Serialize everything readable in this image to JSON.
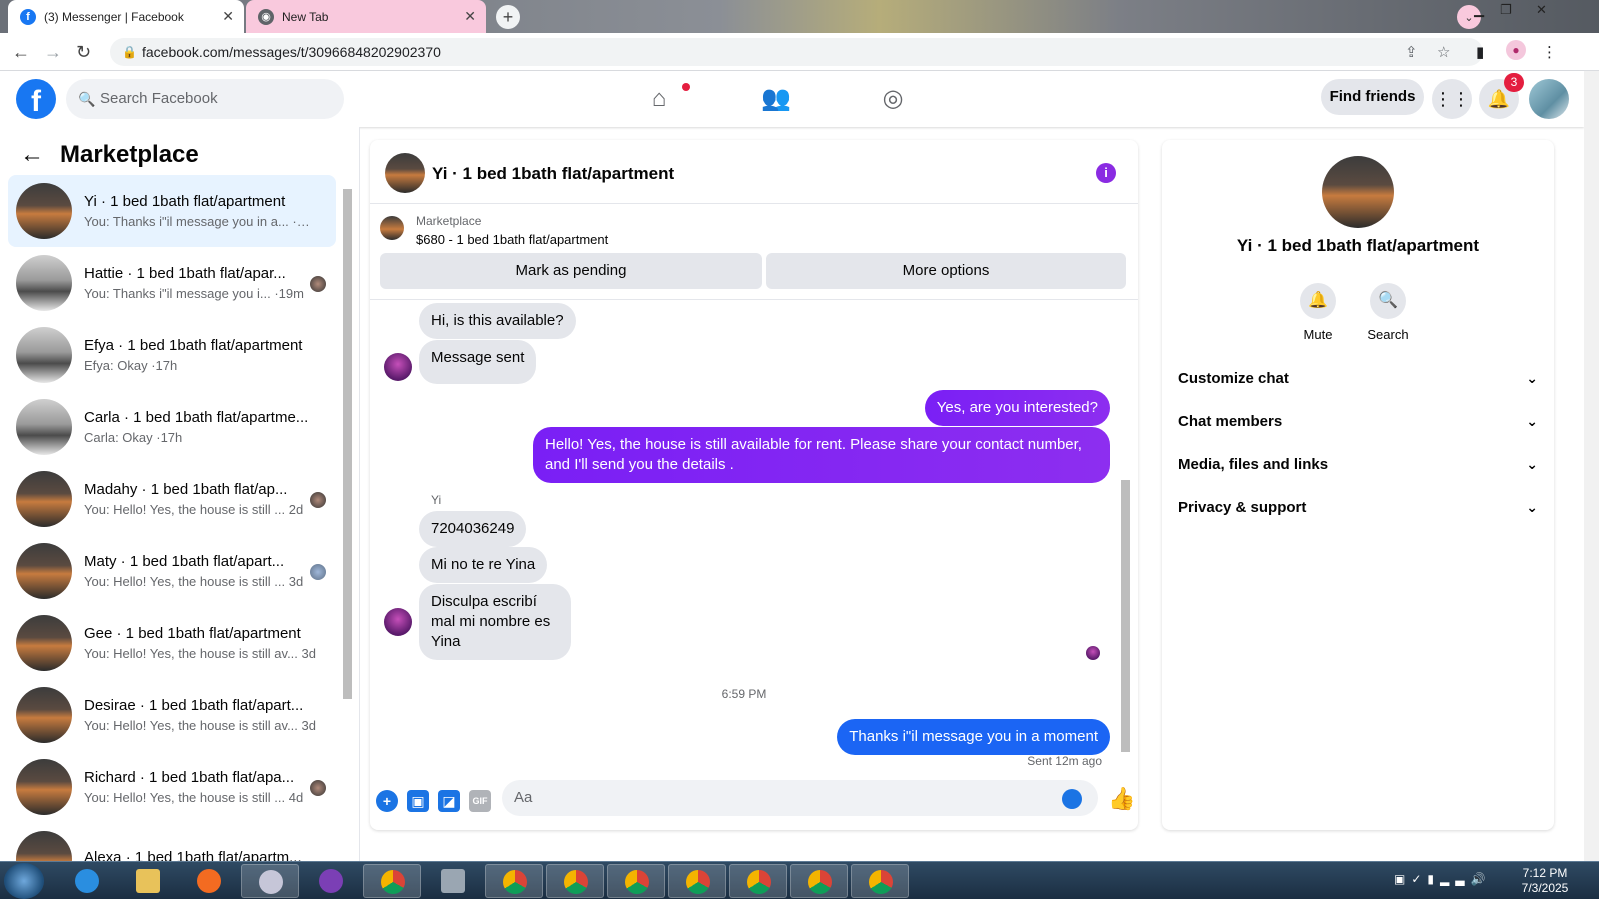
{
  "browser": {
    "tabs": [
      {
        "title": "(3) Messenger | Facebook",
        "active": true
      },
      {
        "title": "New Tab",
        "active": false
      }
    ],
    "url": "facebook.com/messages/t/30966848202902370"
  },
  "fb_nav": {
    "search_placeholder": "Search Facebook",
    "find_friends": "Find friends",
    "notification_count": "3"
  },
  "left": {
    "title": "Marketplace",
    "conversations": [
      {
        "name": "Yi · 1 bed 1bath flat/apartment",
        "snippet": "You: Thanks i\"il message you in a... ·12m"
      },
      {
        "name": "Hattie · 1 bed 1bath flat/apar...",
        "snippet": "You: Thanks i\"il message you i... ·19m"
      },
      {
        "name": "Efya · 1 bed 1bath flat/apartment",
        "snippet": "Efya: Okay ·17h"
      },
      {
        "name": "Carla · 1 bed 1bath flat/apartme...",
        "snippet": "Carla: Okay ·17h"
      },
      {
        "name": "Madahy · 1 bed 1bath flat/ap...",
        "snippet": "You: Hello! Yes, the house is still ... 2d"
      },
      {
        "name": "Maty · 1 bed 1bath flat/apart...",
        "snippet": "You: Hello! Yes, the house is still ... 3d"
      },
      {
        "name": "Gee · 1 bed 1bath flat/apartment",
        "snippet": "You: Hello! Yes, the house is still av... 3d"
      },
      {
        "name": "Desirae · 1 bed 1bath flat/apart...",
        "snippet": "You: Hello! Yes, the house is still av... 3d"
      },
      {
        "name": "Richard · 1 bed 1bath flat/apa...",
        "snippet": "You: Hello! Yes, the house is still ... 4d"
      },
      {
        "name": "Alexa · 1 bed 1bath flat/apartm...",
        "snippet": ""
      }
    ]
  },
  "chat": {
    "title": "Yi · 1 bed 1bath flat/apartment",
    "marketplace_label": "Marketplace",
    "listing": "$680 - 1 bed 1bath flat/apartment",
    "mark_pending": "Mark as pending",
    "more_options": "More options",
    "messages": {
      "m1": "Hi, is this available?",
      "m2": "Message sent",
      "m3": "Yes, are you interested?",
      "m4": "Hello! Yes, the house is still available for rent. Please share your contact number, and I'll send you the details .",
      "sender_label": "Yi",
      "m5": "7204036249",
      "m6": "Mi no te re Yina",
      "m7": "Disculpa escribí mal mi nombre es Yina",
      "time": "6:59 PM",
      "m8": "Thanks i\"il message you in a moment",
      "status": "Sent 12m ago"
    },
    "composer_placeholder": "Aa"
  },
  "right": {
    "name": "Yi · 1 bed 1bath flat/apartment",
    "mute": "Mute",
    "search": "Search",
    "rows": [
      "Customize chat",
      "Chat members",
      "Media, files and links",
      "Privacy & support"
    ]
  },
  "taskbar": {
    "time": "7:12 PM",
    "date": "7/3/2025"
  }
}
